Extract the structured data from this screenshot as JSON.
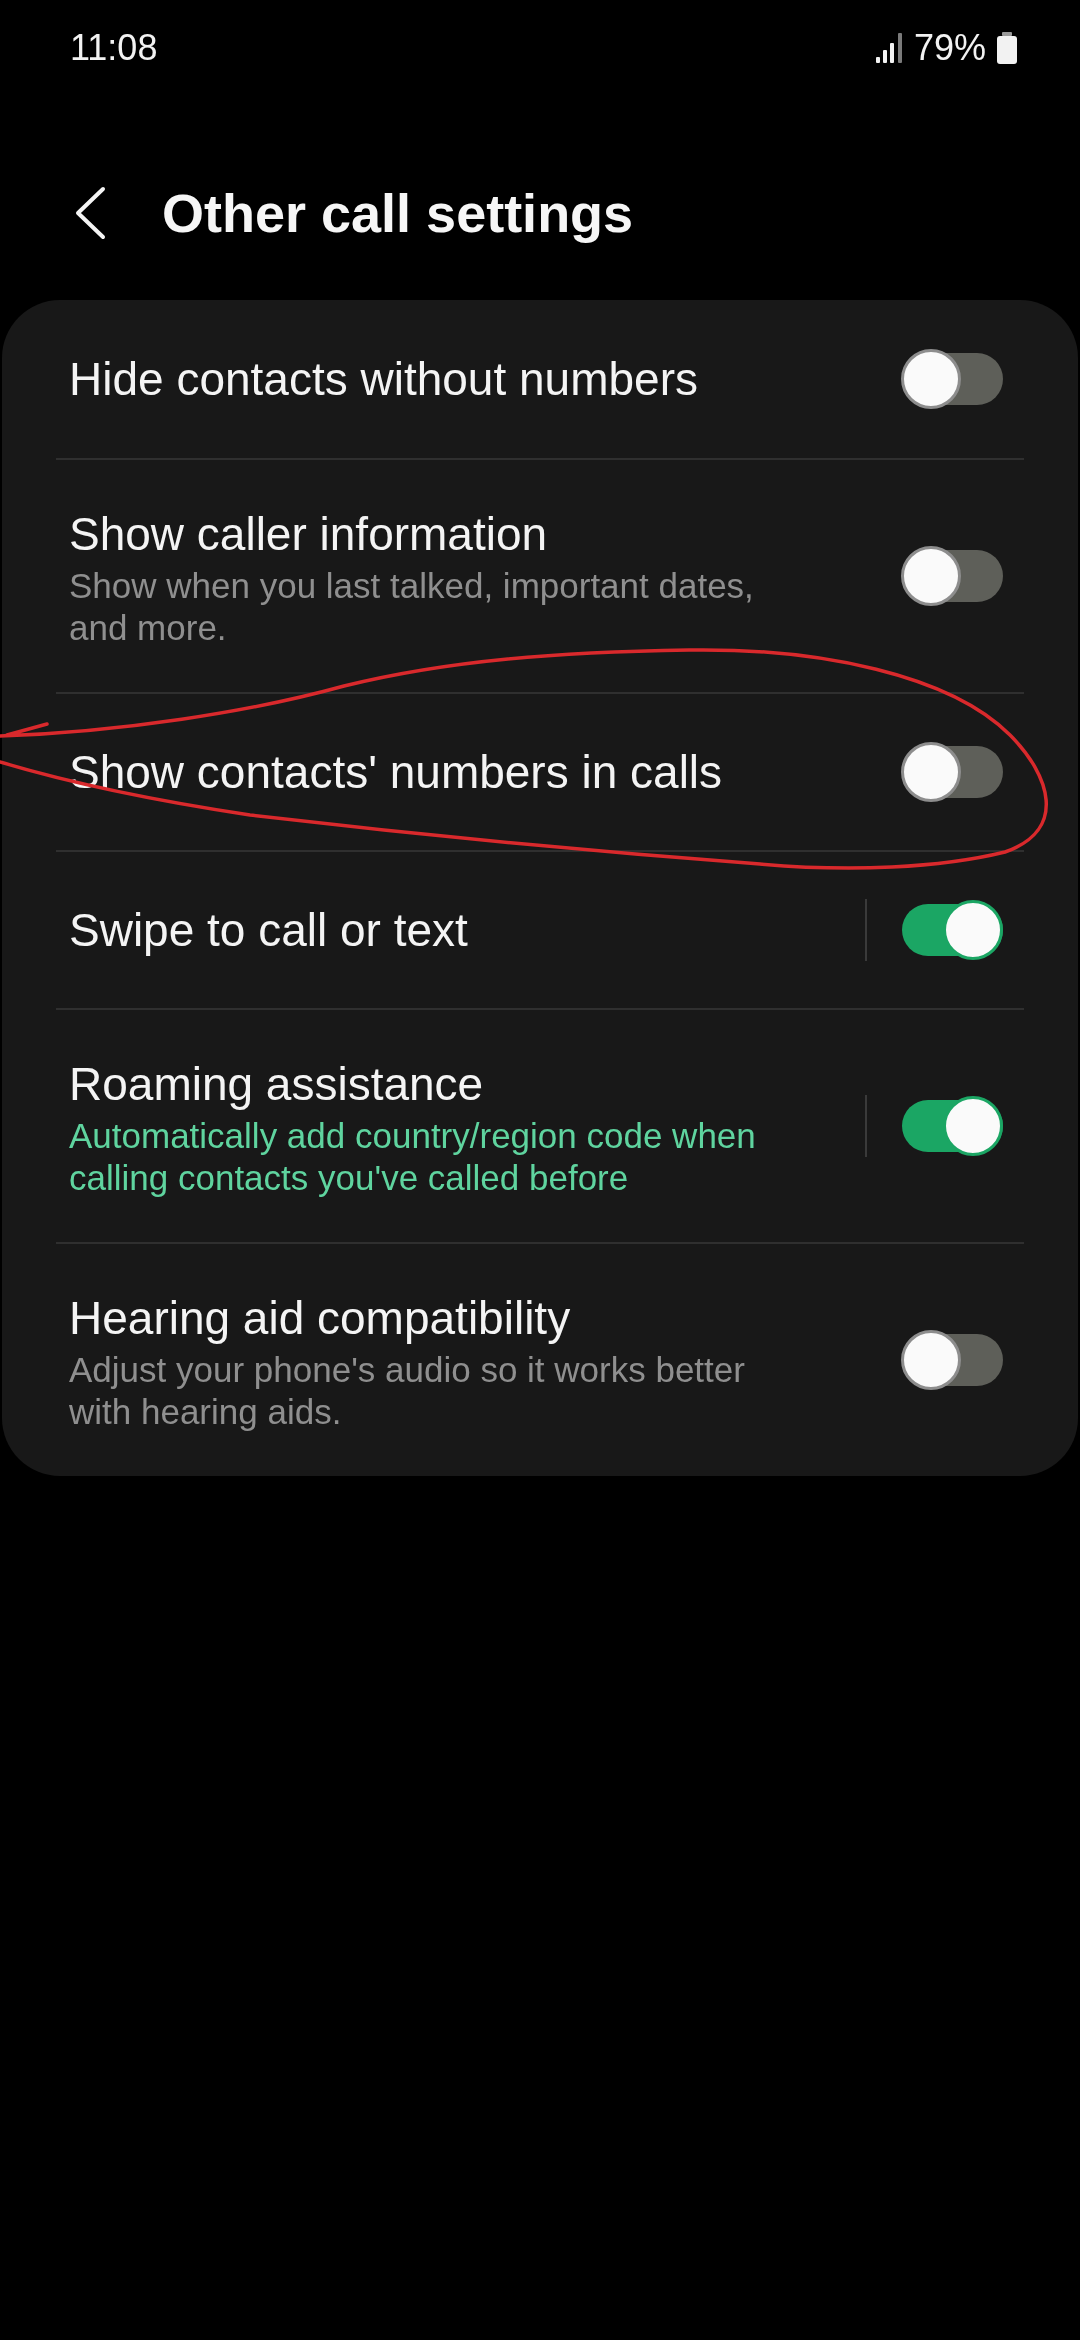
{
  "status_bar": {
    "time": "11:08",
    "battery": "79%"
  },
  "header": {
    "title": "Other call settings"
  },
  "settings": [
    {
      "kind": "toggle",
      "title": "Hide contacts without numbers",
      "on": false
    },
    {
      "kind": "toggle",
      "title": "Show caller information",
      "subtitle": "Show when you last talked, important dates, and more.",
      "subtitle_accent": false,
      "on": false
    },
    {
      "kind": "toggle",
      "title": "Show contacts' numbers in calls",
      "on": false
    },
    {
      "kind": "split_toggle",
      "title": "Swipe to call or text",
      "on": true
    },
    {
      "kind": "split_toggle",
      "title": "Roaming assistance",
      "subtitle": "Automatically add country/region code when calling contacts you've called before",
      "subtitle_accent": true,
      "on": true
    },
    {
      "kind": "toggle",
      "title": "Hearing aid compatibility",
      "subtitle": "Adjust your phone's audio so it works better with hearing aids.",
      "subtitle_accent": false,
      "on": false
    }
  ]
}
